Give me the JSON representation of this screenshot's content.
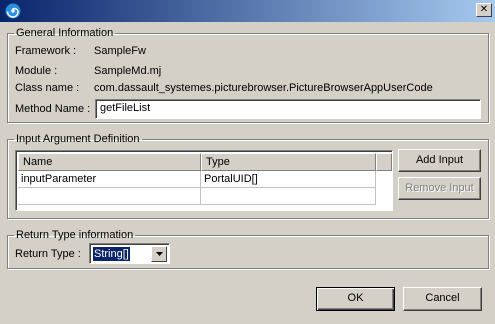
{
  "window": {
    "close_glyph": "✕",
    "icon": "app-spiral-icon"
  },
  "general": {
    "legend": "General Information",
    "framework_label": "Framework :",
    "framework_value": "SampleFw",
    "module_label": "Module :",
    "module_value": "SampleMd.mj",
    "classname_label": "Class name :",
    "classname_value": "com.dassault_systemes.picturebrowser.PictureBrowserAppUserCode",
    "method_label": "Method Name :",
    "method_value": "getFileList"
  },
  "input_args": {
    "legend": "Input Argument Definition",
    "columns": [
      "Name",
      "Type"
    ],
    "rows": [
      [
        "inputParameter",
        "PortalUID[]"
      ]
    ],
    "add_button": "Add Input",
    "remove_button": "Remove Input"
  },
  "return_type": {
    "legend": "Return Type information",
    "label": "Return Type :",
    "value": "String[]"
  },
  "footer": {
    "ok": "OK",
    "cancel": "Cancel"
  },
  "colors": {
    "title_start": "#0a246a",
    "title_end": "#a6caf0",
    "face": "#d4d0c8",
    "selection": "#0a246a"
  }
}
